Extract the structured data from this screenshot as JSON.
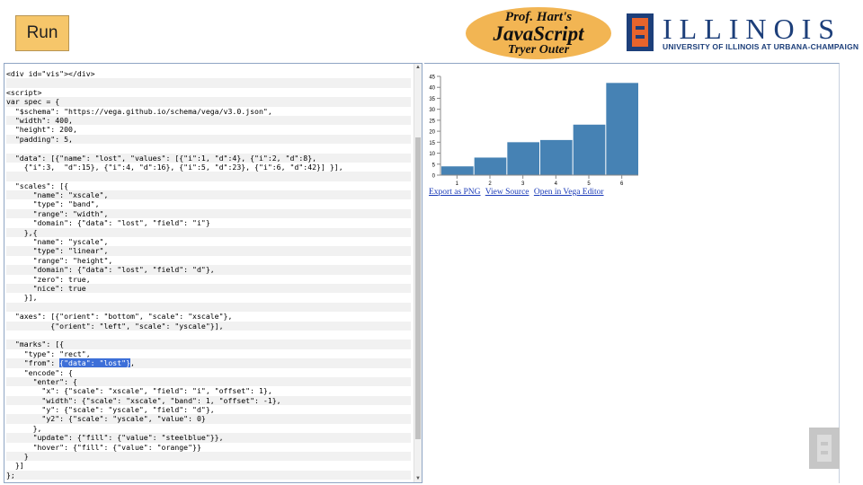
{
  "toolbar": {
    "run_label": "Run"
  },
  "tryer_logo": {
    "line1": "Prof. Hart's",
    "line2": "JavaScript",
    "line3": "Tryer Outer"
  },
  "illinois_logo": {
    "wordmark": "ILLINOIS",
    "subtitle": "UNIVERSITY OF ILLINOIS AT URBANA-CHAMPAIGN"
  },
  "editor": {
    "lines": [
      "<div id=\"vis\"></div>",
      "",
      "<script>",
      "var spec = {",
      "  \"$schema\": \"https://vega.github.io/schema/vega/v3.0.json\",",
      "  \"width\": 400,",
      "  \"height\": 200,",
      "  \"padding\": 5,",
      "",
      "  \"data\": [{\"name\": \"lost\", \"values\": [{\"i\":1, \"d\":4}, {\"i\":2, \"d\":8},",
      "    {\"i\":3,  \"d\":15}, {\"i\":4, \"d\":16}, {\"i\":5, \"d\":23}, {\"i\":6, \"d\":42}] }],",
      "",
      "  \"scales\": [{",
      "      \"name\": \"xscale\",",
      "      \"type\": \"band\",",
      "      \"range\": \"width\",",
      "      \"domain\": {\"data\": \"lost\", \"field\": \"i\"}",
      "    },{",
      "      \"name\": \"yscale\",",
      "      \"type\": \"linear\",",
      "      \"range\": \"height\",",
      "      \"domain\": {\"data\": \"lost\", \"field\": \"d\"},",
      "      \"zero\": true,",
      "      \"nice\": true",
      "    }],",
      "",
      "  \"axes\": [{\"orient\": \"bottom\", \"scale\": \"xscale\"},",
      "          {\"orient\": \"left\", \"scale\": \"yscale\"}],",
      "",
      "  \"marks\": [{",
      "    \"type\": \"rect\",",
      "    \"from\": {\"data\": \"lost\"},",
      "    \"encode\": {",
      "      \"enter\": {",
      "        \"x\": {\"scale\": \"xscale\", \"field\": \"i\", \"offset\": 1},",
      "        \"width\": {\"scale\": \"xscale\", \"band\": 1, \"offset\": -1},",
      "        \"y\": {\"scale\": \"yscale\", \"field\": \"d\"},",
      "        \"y2\": {\"scale\": \"yscale\", \"value\": 0}",
      "      },",
      "      \"update\": {\"fill\": {\"value\": \"steelblue\"}},",
      "      \"hover\": {\"fill\": {\"value\": \"orange\"}}",
      "    }",
      "  }]",
      "};"
    ],
    "selection": {
      "line": 31,
      "text": "{\"data\": \"lost\"}"
    }
  },
  "chart_data": {
    "type": "bar",
    "categories": [
      "1",
      "2",
      "3",
      "4",
      "5",
      "6"
    ],
    "values": [
      4,
      8,
      15,
      16,
      23,
      42
    ],
    "ylim": [
      0,
      45
    ],
    "yticks": [
      0,
      5,
      10,
      15,
      20,
      25,
      30,
      35,
      40,
      45
    ],
    "bar_color": "#4682b4",
    "grid": false
  },
  "output": {
    "links": [
      {
        "label": "Export as PNG"
      },
      {
        "label": "View Source"
      },
      {
        "label": "Open in Vega Editor"
      }
    ]
  }
}
